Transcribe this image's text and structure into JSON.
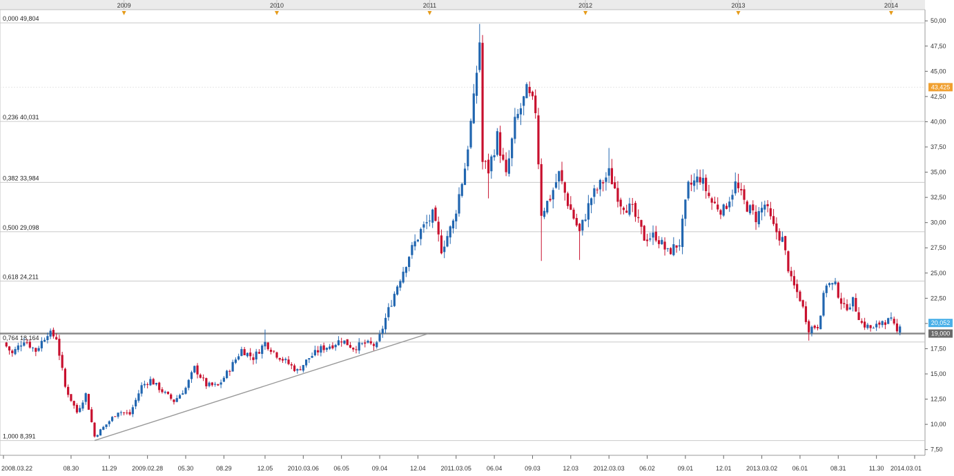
{
  "chart_data": {
    "type": "candlestick",
    "title": "",
    "xlabel": "",
    "ylabel": "",
    "ylim": [
      7.0,
      50.7
    ],
    "x_range": [
      "2008-03-22",
      "2014-03-01"
    ],
    "grid": "horizontal at Fibonacci levels",
    "colors": {
      "up": "#2166b0",
      "down": "#c8102e",
      "grid": "#cccccc",
      "trendline": "#999999",
      "support_line": "#7a7a7a",
      "event_marker": "#e59b1a"
    },
    "y_ticks": [
      "50,00",
      "47,50",
      "45,00",
      "42,50",
      "40,00",
      "37,50",
      "35,00",
      "32,50",
      "30,00",
      "27,50",
      "25,00",
      "22,50",
      "20,00",
      "17,50",
      "15,00",
      "12,50",
      "10,00",
      "7,50"
    ],
    "x_ticks": [
      "2008.03.22",
      "08.30",
      "11.29",
      "2009.02.28",
      "05.30",
      "08.29",
      "12.05",
      "2010.03.06",
      "06.05",
      "09.04",
      "12.04",
      "2011.03.05",
      "06.04",
      "09.03",
      "12.03",
      "2012.03.03",
      "06.02",
      "09.01",
      "12.01",
      "2013.03.02",
      "06.01",
      "08.31",
      "11.30",
      "2014.03.01"
    ],
    "years_top": [
      "2009",
      "2010",
      "2011",
      "2012",
      "2013",
      "2014"
    ],
    "fib_levels": [
      {
        "label": "0,000 49,804",
        "value": 49.804
      },
      {
        "label": "0,236 40,031",
        "value": 40.031
      },
      {
        "label": "0,382 33,984",
        "value": 33.984
      },
      {
        "label": "0,500 29,098",
        "value": 29.098
      },
      {
        "label": "0,618 24,211",
        "value": 24.211
      },
      {
        "label": "0,764 18,164",
        "value": 18.164
      },
      {
        "label": "1,000 8,391",
        "value": 8.391
      }
    ],
    "horizontal_lines": [
      {
        "value": 43.425,
        "label": "43,425",
        "color": "#f0a030",
        "style": "dotted"
      },
      {
        "value": 20.052,
        "label": "20,052",
        "color": "#4ab0e8",
        "style": "none"
      },
      {
        "value": 19.0,
        "label": "19,000",
        "color": "#666666",
        "style": "solid"
      }
    ],
    "trendline": [
      {
        "x": "2008-10-25",
        "y": 8.4
      },
      {
        "x": "2010-10-16",
        "y": 19.0
      }
    ],
    "path_points": [
      {
        "x": "2008-03-22",
        "y": 18.1
      },
      {
        "x": "2008-04-12",
        "y": 17.0
      },
      {
        "x": "2008-05-10",
        "y": 18.4
      },
      {
        "x": "2008-06-07",
        "y": 17.3
      },
      {
        "x": "2008-07-05",
        "y": 19.1
      },
      {
        "x": "2008-07-26",
        "y": 18.6
      },
      {
        "x": "2008-08-16",
        "y": 13.7
      },
      {
        "x": "2008-09-13",
        "y": 11.2
      },
      {
        "x": "2008-10-04",
        "y": 13.0
      },
      {
        "x": "2008-10-25",
        "y": 8.8
      },
      {
        "x": "2008-11-22",
        "y": 10.0
      },
      {
        "x": "2008-12-20",
        "y": 11.3
      },
      {
        "x": "2009-01-17",
        "y": 11.0
      },
      {
        "x": "2009-02-14",
        "y": 13.8
      },
      {
        "x": "2009-03-07",
        "y": 14.4
      },
      {
        "x": "2009-04-04",
        "y": 13.3
      },
      {
        "x": "2009-05-02",
        "y": 12.3
      },
      {
        "x": "2009-05-30",
        "y": 13.6
      },
      {
        "x": "2009-06-20",
        "y": 15.6
      },
      {
        "x": "2009-07-18",
        "y": 13.9
      },
      {
        "x": "2009-08-15",
        "y": 13.8
      },
      {
        "x": "2009-09-12",
        "y": 15.5
      },
      {
        "x": "2009-10-10",
        "y": 17.4
      },
      {
        "x": "2009-11-07",
        "y": 16.6
      },
      {
        "x": "2009-12-05",
        "y": 18.1
      },
      {
        "x": "2010-01-02",
        "y": 16.9
      },
      {
        "x": "2010-01-30",
        "y": 16.0
      },
      {
        "x": "2010-02-20",
        "y": 15.3
      },
      {
        "x": "2010-03-20",
        "y": 16.6
      },
      {
        "x": "2010-04-17",
        "y": 17.5
      },
      {
        "x": "2010-05-15",
        "y": 17.9
      },
      {
        "x": "2010-06-05",
        "y": 18.4
      },
      {
        "x": "2010-07-03",
        "y": 17.6
      },
      {
        "x": "2010-07-31",
        "y": 18.0
      },
      {
        "x": "2010-08-28",
        "y": 17.8
      },
      {
        "x": "2010-09-18",
        "y": 20.5
      },
      {
        "x": "2010-10-16",
        "y": 23.8
      },
      {
        "x": "2010-11-13",
        "y": 26.8
      },
      {
        "x": "2010-12-11",
        "y": 29.2
      },
      {
        "x": "2011-01-08",
        "y": 30.7
      },
      {
        "x": "2011-01-29",
        "y": 27.4
      },
      {
        "x": "2011-02-26",
        "y": 30.0
      },
      {
        "x": "2011-03-26",
        "y": 35.5
      },
      {
        "x": "2011-04-16",
        "y": 42.0
      },
      {
        "x": "2011-04-30",
        "y": 48.0
      },
      {
        "x": "2011-05-07",
        "y": 36.0
      },
      {
        "x": "2011-05-21",
        "y": 35.2
      },
      {
        "x": "2011-06-11",
        "y": 38.5
      },
      {
        "x": "2011-07-02",
        "y": 34.5
      },
      {
        "x": "2011-07-23",
        "y": 39.8
      },
      {
        "x": "2011-08-20",
        "y": 42.9
      },
      {
        "x": "2011-09-10",
        "y": 41.2
      },
      {
        "x": "2011-09-24",
        "y": 31.0
      },
      {
        "x": "2011-10-15",
        "y": 32.5
      },
      {
        "x": "2011-11-05",
        "y": 34.8
      },
      {
        "x": "2011-11-26",
        "y": 32.0
      },
      {
        "x": "2011-12-24",
        "y": 29.0
      },
      {
        "x": "2012-01-21",
        "y": 32.5
      },
      {
        "x": "2012-02-11",
        "y": 33.7
      },
      {
        "x": "2012-03-03",
        "y": 34.9
      },
      {
        "x": "2012-03-31",
        "y": 32.0
      },
      {
        "x": "2012-04-28",
        "y": 31.2
      },
      {
        "x": "2012-05-26",
        "y": 28.5
      },
      {
        "x": "2012-06-23",
        "y": 28.7
      },
      {
        "x": "2012-07-21",
        "y": 27.0
      },
      {
        "x": "2012-08-18",
        "y": 28.0
      },
      {
        "x": "2012-09-08",
        "y": 33.5
      },
      {
        "x": "2012-10-06",
        "y": 34.5
      },
      {
        "x": "2012-11-03",
        "y": 32.0
      },
      {
        "x": "2012-12-01",
        "y": 31.2
      },
      {
        "x": "2012-12-29",
        "y": 33.8
      },
      {
        "x": "2013-01-19",
        "y": 32.0
      },
      {
        "x": "2013-02-16",
        "y": 30.5
      },
      {
        "x": "2013-03-09",
        "y": 31.8
      },
      {
        "x": "2013-03-30",
        "y": 29.5
      },
      {
        "x": "2013-04-20",
        "y": 28.3
      },
      {
        "x": "2013-05-11",
        "y": 24.2
      },
      {
        "x": "2013-06-01",
        "y": 22.5
      },
      {
        "x": "2013-06-22",
        "y": 19.5
      },
      {
        "x": "2013-07-13",
        "y": 19.8
      },
      {
        "x": "2013-08-03",
        "y": 24.0
      },
      {
        "x": "2013-08-24",
        "y": 23.7
      },
      {
        "x": "2013-09-14",
        "y": 21.5
      },
      {
        "x": "2013-10-05",
        "y": 22.2
      },
      {
        "x": "2013-10-26",
        "y": 20.0
      },
      {
        "x": "2013-11-23",
        "y": 19.4
      },
      {
        "x": "2013-12-14",
        "y": 20.3
      },
      {
        "x": "2014-01-04",
        "y": 20.2
      },
      {
        "x": "2014-01-18",
        "y": 19.1
      }
    ],
    "last_point": {
      "x": "2014-01-25",
      "y": 20.052
    }
  }
}
